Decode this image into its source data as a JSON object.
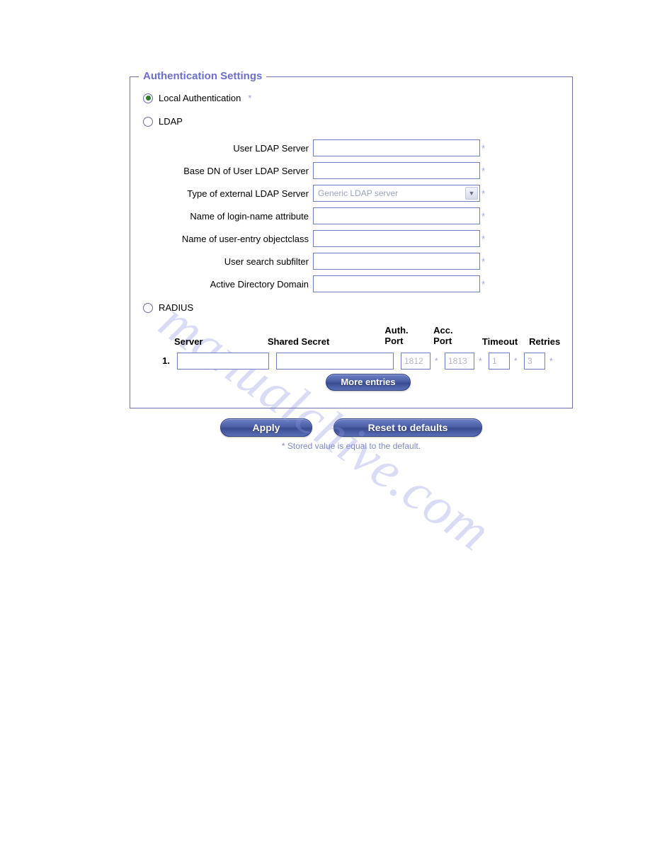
{
  "legend": "Authentication Settings",
  "auth_options": {
    "local": {
      "label": "Local Authentication",
      "star": "*",
      "selected": true
    },
    "ldap": {
      "label": "LDAP",
      "selected": false
    },
    "radius": {
      "label": "RADIUS",
      "selected": false
    }
  },
  "ldap": {
    "rows": [
      {
        "label": "User LDAP Server",
        "value": "",
        "star": "*"
      },
      {
        "label": "Base DN of User LDAP Server",
        "value": "",
        "star": "*"
      },
      {
        "label": "Type of external LDAP Server",
        "value": "Generic LDAP server",
        "star": "*",
        "type": "select"
      },
      {
        "label": "Name of login-name attribute",
        "value": "",
        "star": "*"
      },
      {
        "label": "Name of user-entry objectclass",
        "value": "",
        "star": "*"
      },
      {
        "label": "User search subfilter",
        "value": "",
        "star": "*"
      },
      {
        "label": "Active Directory Domain",
        "value": "",
        "star": "*"
      }
    ]
  },
  "radius": {
    "headers": {
      "server": "Server",
      "secret": "Shared Secret",
      "auth_port": "Auth.\nPort",
      "acc_port": "Acc.\nPort",
      "timeout": "Timeout",
      "retries": "Retries"
    },
    "row": {
      "index": "1.",
      "server": "",
      "secret": "",
      "auth_port": "1812",
      "acc_port": "1813",
      "timeout": "1",
      "retries": "3",
      "star": "*"
    },
    "more_entries": "More entries"
  },
  "buttons": {
    "apply": "Apply",
    "reset": "Reset to defaults"
  },
  "note": "* Stored value is equal to the default.",
  "watermark": "manualchive.com"
}
